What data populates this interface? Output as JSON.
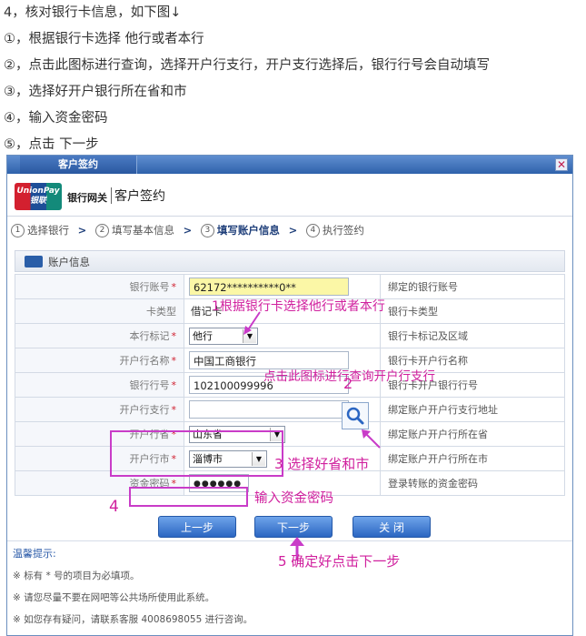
{
  "instructions": [
    "4，核对银行卡信息，如下图↓",
    "①，根据银行卡选择  他行或者本行",
    "②，点击此图标进行查询，选择开户行支行，开户支行选择后，银行行号会自动填写",
    "③，选择好开户银行所在省和市",
    "④，输入资金密码",
    "⑤，点击  下一步"
  ],
  "dialog": {
    "title": "客户签约",
    "close_glyph": "✕",
    "brand": {
      "logo_top": "UnionPay",
      "logo_bottom": "银联",
      "gateway": "银行网关",
      "title": "客户签约"
    },
    "steps": [
      {
        "num": "1",
        "label": "选择银行"
      },
      {
        "num": "2",
        "label": "填写基本信息"
      },
      {
        "num": "3",
        "label": "填写账户信息"
      },
      {
        "num": "4",
        "label": "执行签约"
      }
    ],
    "active_step": 2,
    "section_title": "账户信息",
    "rows": [
      {
        "label": "银行账号",
        "required": true,
        "value": "62172**********0**",
        "hint": "绑定的银行账号"
      },
      {
        "label": "卡类型",
        "required": false,
        "value": "借记卡",
        "hint": "银行卡类型"
      },
      {
        "label": "本行标记",
        "required": true,
        "value": "他行",
        "hint": "银行卡标记及区域"
      },
      {
        "label": "开户行名称",
        "required": true,
        "value": "中国工商银行",
        "hint": "银行卡开户行名称"
      },
      {
        "label": "银行行号",
        "required": true,
        "value": "102100099996",
        "hint": "银行卡开户银行行号"
      },
      {
        "label": "开户行支行",
        "required": true,
        "value": "",
        "hint": "绑定账户开户行支行地址"
      },
      {
        "label": "开户行省",
        "required": true,
        "value": "山东省",
        "hint": "绑定账户开户行所在省"
      },
      {
        "label": "开户行市",
        "required": true,
        "value": "淄博市",
        "hint": "绑定账户开户行所在市"
      },
      {
        "label": "资金密码",
        "required": true,
        "value": "●●●●●●",
        "hint": "登录转账的资金密码"
      }
    ],
    "required_mark": "*",
    "buttons": {
      "prev": "上一步",
      "next": "下一步",
      "close": "关 闭"
    },
    "tips": {
      "title": "温馨提示:",
      "lines": [
        "※ 标有 * 号的项目为必填项。",
        "※ 请您尽量不要在网吧等公共场所使用此系统。",
        "※ 如您存有疑问，请联系客服 4008698055 进行咨询。"
      ]
    }
  },
  "annotations": {
    "a1": "1根据银行卡选择他行或者本行",
    "a2_text": "点击此图标进行查询开户行支行",
    "a2_num": "2",
    "a3": "3 选择好省和市",
    "a4_num": "4",
    "a4_text": "输入资金密码",
    "a5": "5  确定好点击下一步"
  },
  "colors": {
    "annotation": "#d0209e",
    "titlebar": "#2f62ab",
    "button": "#2b66c2"
  }
}
